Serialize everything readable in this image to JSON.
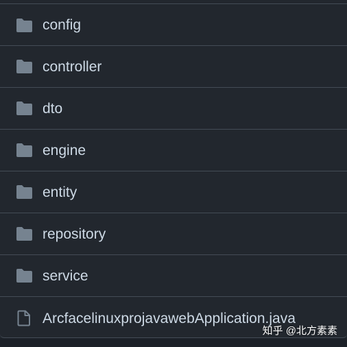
{
  "files": [
    {
      "name": "config",
      "type": "folder",
      "icon": "folder-icon"
    },
    {
      "name": "controller",
      "type": "folder",
      "icon": "folder-icon"
    },
    {
      "name": "dto",
      "type": "folder",
      "icon": "folder-icon"
    },
    {
      "name": "engine",
      "type": "folder",
      "icon": "folder-icon"
    },
    {
      "name": "entity",
      "type": "folder",
      "icon": "folder-icon"
    },
    {
      "name": "repository",
      "type": "folder",
      "icon": "folder-icon"
    },
    {
      "name": "service",
      "type": "folder",
      "icon": "folder-icon"
    },
    {
      "name": "ArcfacelinuxprojavawebApplication.java",
      "type": "file",
      "icon": "file-icon"
    }
  ],
  "watermark": "知乎 @北方素素",
  "colors": {
    "background": "#22272e",
    "border": "#444c56",
    "text": "#cdd9e5",
    "folder_icon": "#768390"
  }
}
